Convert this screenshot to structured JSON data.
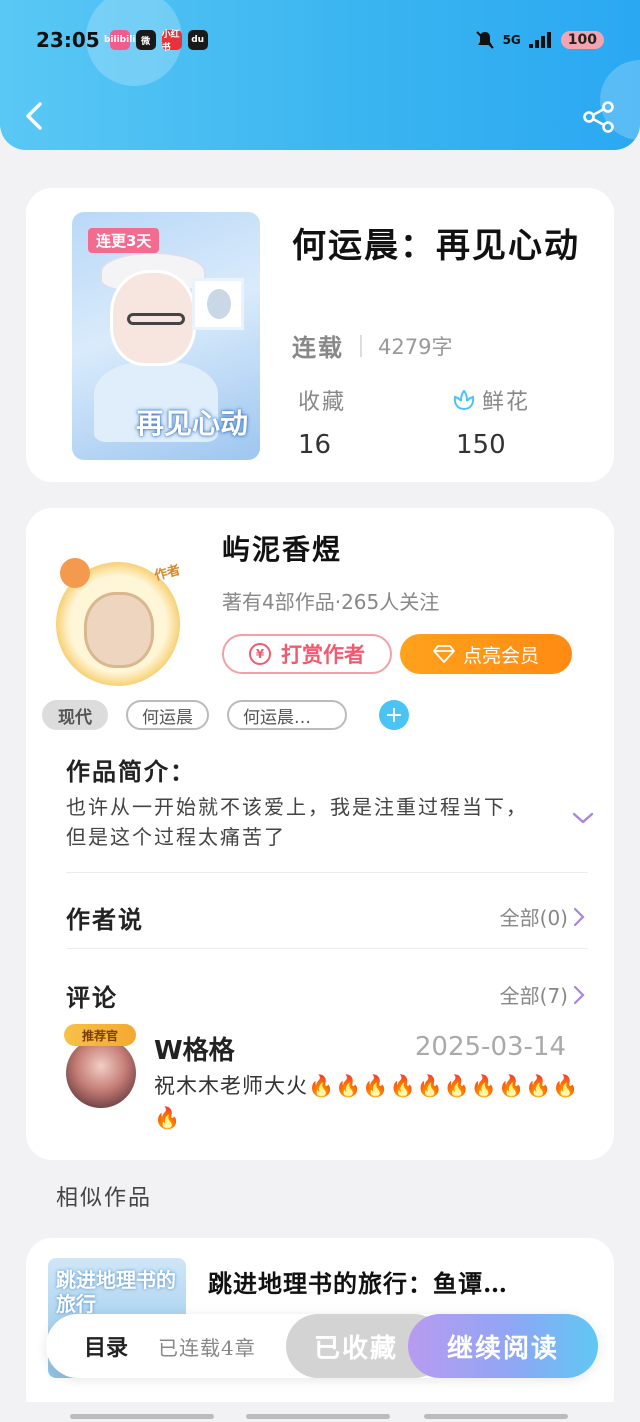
{
  "status_bar": {
    "time": "23:05",
    "apps": [
      "bilibili",
      "微",
      "小红书",
      "du"
    ],
    "signal": "5G",
    "battery": "100"
  },
  "colors": {
    "header_gradient_start": "#5ac8f5",
    "header_gradient_end": "#2aa8f2",
    "accent_orange": "#ff8a12",
    "tip_red": "#ef5b6f",
    "read_gradient_start": "#b89bf0",
    "read_gradient_end": "#5fc8f3"
  },
  "header": {
    "back_icon": "chevron-left-icon",
    "share_icon": "share-icon"
  },
  "book": {
    "cover_tag": "连更3天",
    "cover_title": "再见心动",
    "title": "何运晨：再见心动",
    "status": "连载",
    "word_count": "4279字",
    "collect_label": "收藏",
    "collect_value": "16",
    "flower_label": "鲜花",
    "flower_value": "150"
  },
  "author": {
    "avatar_tag": "作者",
    "name": "屿泥香煜",
    "meta": "著有4部作品·265人关注",
    "tip_button": "打赏作者",
    "tip_icon_text": "¥",
    "vip_button": "点亮会员",
    "tags": [
      "现代",
      "何运晨",
      "何运晨…"
    ],
    "add_tag": "+"
  },
  "intro": {
    "title": "作品简介：",
    "text": "也许从一开始就不该爱上，我是注重过程当下，但是这个过程太痛苦了"
  },
  "author_says": {
    "title": "作者说",
    "link": "全部(0)"
  },
  "comments": {
    "title": "评论",
    "link": "全部(7)",
    "items": [
      {
        "badge": "推荐官",
        "user": "W格格",
        "date": "2025-03-14",
        "text": "祝木木老师大火🔥🔥🔥🔥🔥🔥🔥🔥🔥🔥🔥"
      }
    ]
  },
  "similar": {
    "title": "相似作品",
    "items": [
      {
        "cover_text": "跳进地理书的旅行",
        "name": "跳进地理书的旅行：鱼谭…"
      }
    ]
  },
  "bottom_bar": {
    "toc": "目录",
    "chapters": "已连载4章",
    "favorited": "已收藏",
    "continue": "继续阅读"
  }
}
